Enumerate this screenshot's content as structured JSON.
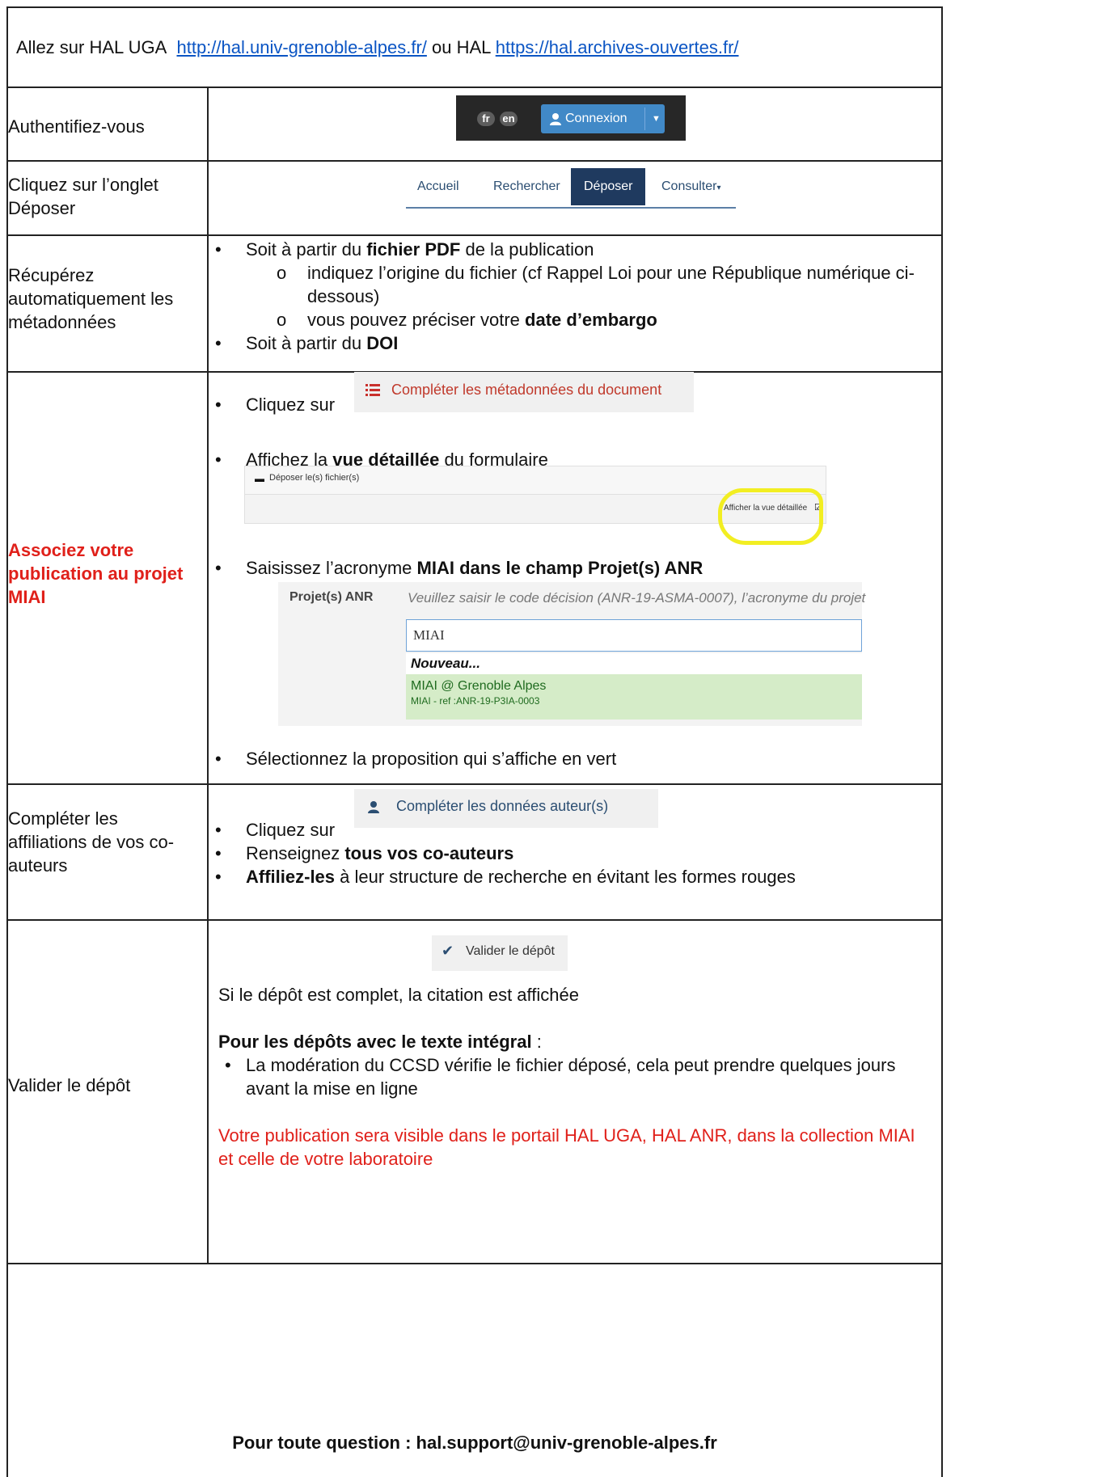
{
  "header": {
    "intro": "Allez sur HAL UGA",
    "link1": "http://hal.univ-grenoble-alpes.fr/",
    "mid": "ou HAL",
    "link2": "https://hal.archives-ouvertes.fr/"
  },
  "rows": {
    "auth": {
      "left": "Authentifiez-vous",
      "lang_fr": "fr",
      "lang_en": "en",
      "connexion": "Connexion"
    },
    "onglet": {
      "left": "Cliquez sur l’onglet Déposer",
      "tabs": [
        "Accueil",
        "Rechercher",
        "Déposer",
        "Consulter"
      ]
    },
    "meta": {
      "left": "Récupérez automatiquement les métadonnées",
      "b1_pre": "Soit à partir du",
      "b1_bold": "fichier PDF",
      "b1_post": "de la publication",
      "s1": "indiquez l’origine du fichier (cf Rappel Loi pour une République numérique ci-dessous)",
      "s2_pre": "vous pouvez préciser votre",
      "s2_bold": "date d’embargo",
      "b2_pre": "Soit à partir du",
      "b2_bold": "DOI"
    },
    "miai": {
      "left": "Associez votre publication au projet MIAI",
      "click": "Cliquez sur",
      "btn_meta": "Compléter les métadonnées du document",
      "b2_pre": "Affichez la",
      "b2_bold": "vue détaillée",
      "b2_post": "du formulaire",
      "deposer_files": "Déposer le(s) fichier(s)",
      "afficher_vue": "Afficher la vue détaillée",
      "b3_pre": "Saisissez l’acronyme",
      "b3_bold": "MIAI dans le champ Projet(s) ANR",
      "anr_label": "Projet(s) ANR",
      "anr_help": "Veuillez saisir le code décision (ANR-19-ASMA-0007), l’acronyme du projet",
      "anr_input": "MIAI",
      "anr_nouveau": "Nouveau...",
      "anr_prop1": "MIAI @ Grenoble Alpes",
      "anr_prop2": "MIAI - ref :ANR-19-P3IA-0003",
      "b4": "Sélectionnez la proposition qui s’affiche en vert"
    },
    "auteurs": {
      "left": "Compléter les affiliations de vos co-auteurs",
      "click": "Cliquez sur",
      "btn_auteurs": "Compléter les données auteur(s)",
      "b2_pre": "Renseignez",
      "b2_bold": "tous vos co-auteurs",
      "b3_bold": "Affiliez-les",
      "b3_post": "à leur structure de recherche en évitant les formes rouges"
    },
    "valider": {
      "left": "Valider le dépôt",
      "btn": "Valider le dépôt",
      "line1": "Si le dépôt est complet, la citation est affichée",
      "heading_bold": "Pour les dépôts avec le texte intégral",
      "heading_post": ":",
      "bullet": "La modération du CCSD vérifie le fichier déposé, cela peut prendre quelques jours avant la mise en ligne",
      "red_note": "Votre publication sera visible dans le portail HAL UGA, HAL ANR, dans la collection MIAI et celle de votre laboratoire"
    }
  },
  "footer": {
    "text": "Pour toute question : hal.support@univ-grenoble-alpes.fr"
  },
  "colors": {
    "accent_red": "#e0201a",
    "link_blue": "#0b55c4",
    "hal_blue": "#4189c7",
    "tab_active": "#1f3a5f"
  }
}
